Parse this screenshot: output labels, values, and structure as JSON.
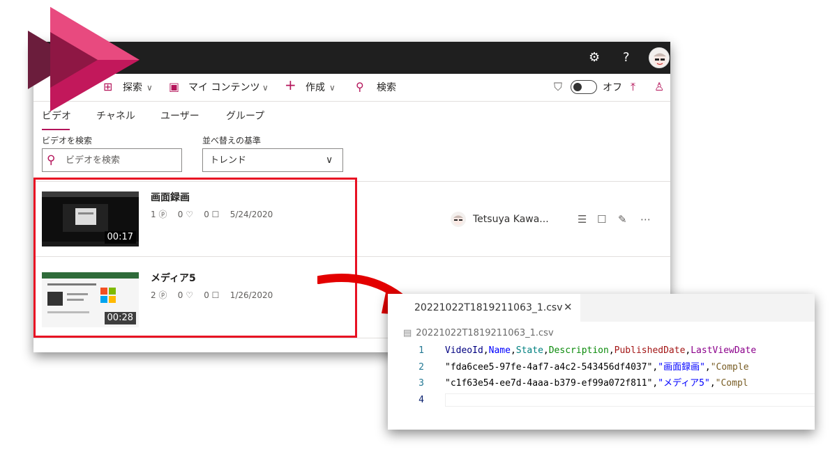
{
  "topbar": {
    "settings_icon": "gear-icon",
    "help_label": "?"
  },
  "nav": {
    "explore_label": "探索",
    "my_content_label": "マイ コンテンツ",
    "create_label": "作成",
    "search_label": "検索",
    "toggle_label": "オフ"
  },
  "tabs": [
    "ビデオ",
    "チャネル",
    "ユーザー",
    "グループ"
  ],
  "filters": {
    "search_label": "ビデオを検索",
    "search_placeholder": "ビデオを検索",
    "sort_label": "並べ替えの基準",
    "sort_value": "トレンド"
  },
  "videos": [
    {
      "title": "画面録画",
      "views": "1",
      "likes": "0",
      "comments": "0",
      "date": "5/24/2020",
      "duration": "00:17"
    },
    {
      "title": "メディア5",
      "views": "2",
      "likes": "0",
      "comments": "0",
      "date": "1/26/2020",
      "duration": "00:28"
    }
  ],
  "owner_name": "Tetsuya Kawa...",
  "editor": {
    "tab_name": "20221022T1819211063_1.csv",
    "close_glyph": "✕",
    "breadcrumb": "20221022T1819211063_1.csv",
    "line_numbers": [
      "1",
      "2",
      "3",
      "4"
    ],
    "header_cols": [
      "VideoId",
      "Name",
      "State",
      "Description",
      "PublishedDate",
      "LastViewDate"
    ],
    "row2": [
      "\"fda6cee5-97fe-4af7-a4c2-543456df4037\"",
      "\"画面録画\"",
      "\"Comple"
    ],
    "row3": [
      "\"c1f63e54-ee7d-4aaa-b379-ef99a072f811\"",
      "\"メディア5\"",
      "\"Compl"
    ]
  },
  "colors": {
    "accent": "#b4145a",
    "highlight": "#e81123",
    "topbar": "#1f1f1f"
  }
}
